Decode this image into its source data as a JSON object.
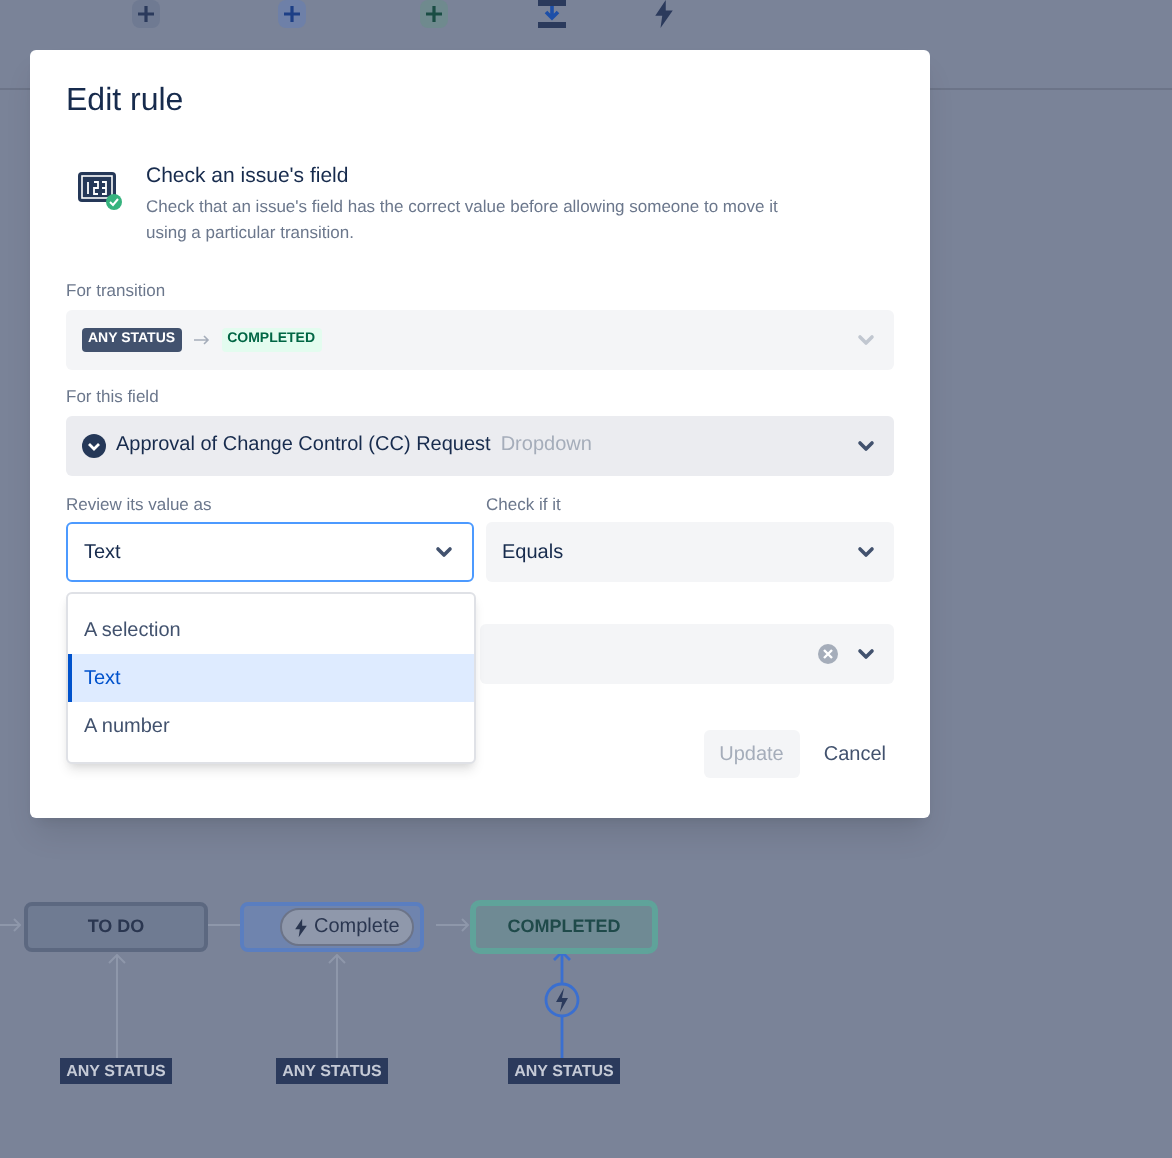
{
  "modal": {
    "title": "Edit rule",
    "rule": {
      "title": "Check an issue's field",
      "description": "Check that an issue's field has the correct value before allowing someone to move it using a particular transition."
    },
    "transition": {
      "label": "For transition",
      "from": "ANY STATUS",
      "to": "COMPLETED"
    },
    "field": {
      "label": "For this field",
      "value": "Approval of Change Control (CC) Request",
      "type": "Dropdown"
    },
    "review": {
      "label": "Review its value as",
      "value": "Text",
      "focused": true,
      "options": [
        {
          "label": "A selection",
          "selected": false
        },
        {
          "label": "Text",
          "selected": true
        },
        {
          "label": "A number",
          "selected": false
        }
      ]
    },
    "check": {
      "label": "Check if it",
      "value": "Equals"
    },
    "buttons": [
      {
        "label": "Update",
        "disabled": true
      },
      {
        "label": "Cancel",
        "disabled": false
      }
    ]
  },
  "diagram": {
    "nodes": [
      {
        "kind": "todo",
        "label": "TO DO",
        "incoming": "ANY STATUS",
        "selected": false
      },
      {
        "kind": "progress",
        "transition": "Complete",
        "incoming": "ANY STATUS",
        "selected": false
      },
      {
        "kind": "done",
        "label": "COMPLETED",
        "incoming": "ANY STATUS",
        "selected": true
      }
    ]
  }
}
